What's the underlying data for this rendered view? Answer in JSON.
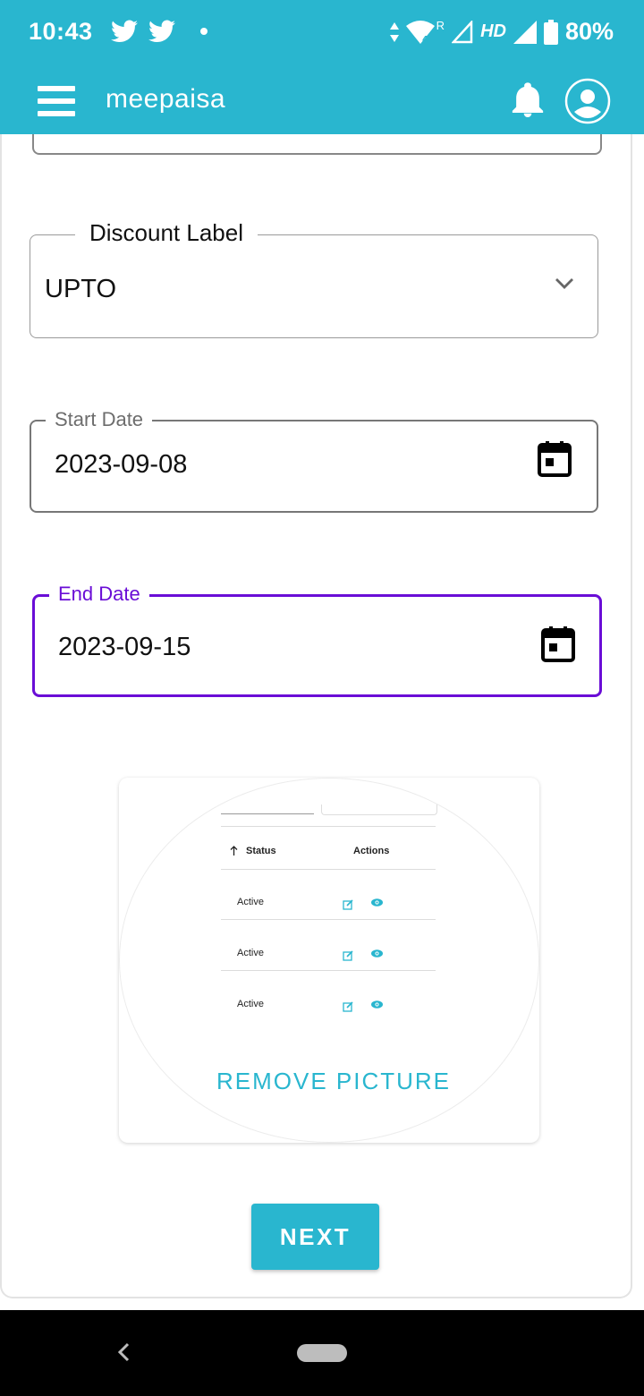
{
  "status_bar": {
    "time": "10:43",
    "network": "HD",
    "roaming": "R",
    "network_gen": "4",
    "battery": "80%"
  },
  "app_bar": {
    "title": "meepaisa",
    "menu_icon": "hamburger-menu-icon",
    "notification_icon": "bell-icon",
    "account_icon": "account-circle-icon"
  },
  "form": {
    "discount_label": {
      "label": "Discount Label",
      "value": "UPTO"
    },
    "start_date": {
      "label": "Start Date",
      "value": "2023-09-08"
    },
    "end_date": {
      "label": "End Date",
      "value": "2023-09-15"
    }
  },
  "picture": {
    "preview": {
      "headers": [
        "Status",
        "Actions"
      ],
      "rows": [
        {
          "status": "Active"
        },
        {
          "status": "Active"
        },
        {
          "status": "Active"
        }
      ]
    },
    "remove_label": "REMOVE PICTURE"
  },
  "next_label": "NEXT",
  "colors": {
    "brand": "#29b6cf",
    "focus": "#6a0dd6"
  }
}
